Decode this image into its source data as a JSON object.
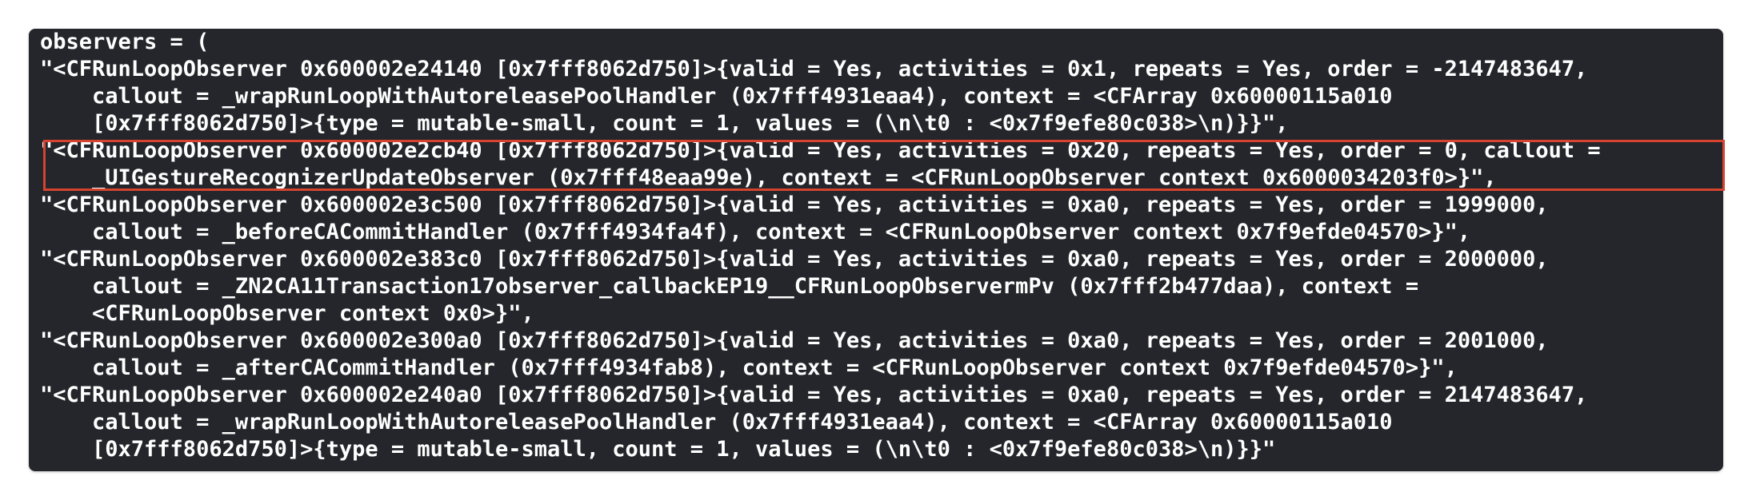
{
  "console": {
    "lines": [
      "observers = (",
      "\"<CFRunLoopObserver 0x600002e24140 [0x7fff8062d750]>{valid = Yes, activities = 0x1, repeats = Yes, order = -2147483647,",
      "    callout = _wrapRunLoopWithAutoreleasePoolHandler (0x7fff4931eaa4), context = <CFArray 0x60000115a010",
      "    [0x7fff8062d750]>{type = mutable-small, count = 1, values = (\\n\\t0 : <0x7f9efe80c038>\\n)}}\",",
      "\"<CFRunLoopObserver 0x600002e2cb40 [0x7fff8062d750]>{valid = Yes, activities = 0x20, repeats = Yes, order = 0, callout =",
      "    _UIGestureRecognizerUpdateObserver (0x7fff48eaa99e), context = <CFRunLoopObserver context 0x6000034203f0>}\",",
      "\"<CFRunLoopObserver 0x600002e3c500 [0x7fff8062d750]>{valid = Yes, activities = 0xa0, repeats = Yes, order = 1999000,",
      "    callout = _beforeCACommitHandler (0x7fff4934fa4f), context = <CFRunLoopObserver context 0x7f9efde04570>}\",",
      "\"<CFRunLoopObserver 0x600002e383c0 [0x7fff8062d750]>{valid = Yes, activities = 0xa0, repeats = Yes, order = 2000000,",
      "    callout = _ZN2CA11Transaction17observer_callbackEP19__CFRunLoopObservermPv (0x7fff2b477daa), context =",
      "    <CFRunLoopObserver context 0x0>}\",",
      "\"<CFRunLoopObserver 0x600002e300a0 [0x7fff8062d750]>{valid = Yes, activities = 0xa0, repeats = Yes, order = 2001000,",
      "    callout = _afterCACommitHandler (0x7fff4934fab8), context = <CFRunLoopObserver context 0x7f9efde04570>}\",",
      "\"<CFRunLoopObserver 0x600002e240a0 [0x7fff8062d750]>{valid = Yes, activities = 0xa0, repeats = Yes, order = 2147483647,",
      "    callout = _wrapRunLoopWithAutoreleasePoolHandler (0x7fff4931eaa4), context = <CFArray 0x60000115a010",
      "    [0x7fff8062d750]>{type = mutable-small, count = 1, values = (\\n\\t0 : <0x7f9efe80c038>\\n)}}\""
    ]
  },
  "colors": {
    "background": "#25262b",
    "text": "#ffffff",
    "highlight_border": "#d6432f"
  }
}
